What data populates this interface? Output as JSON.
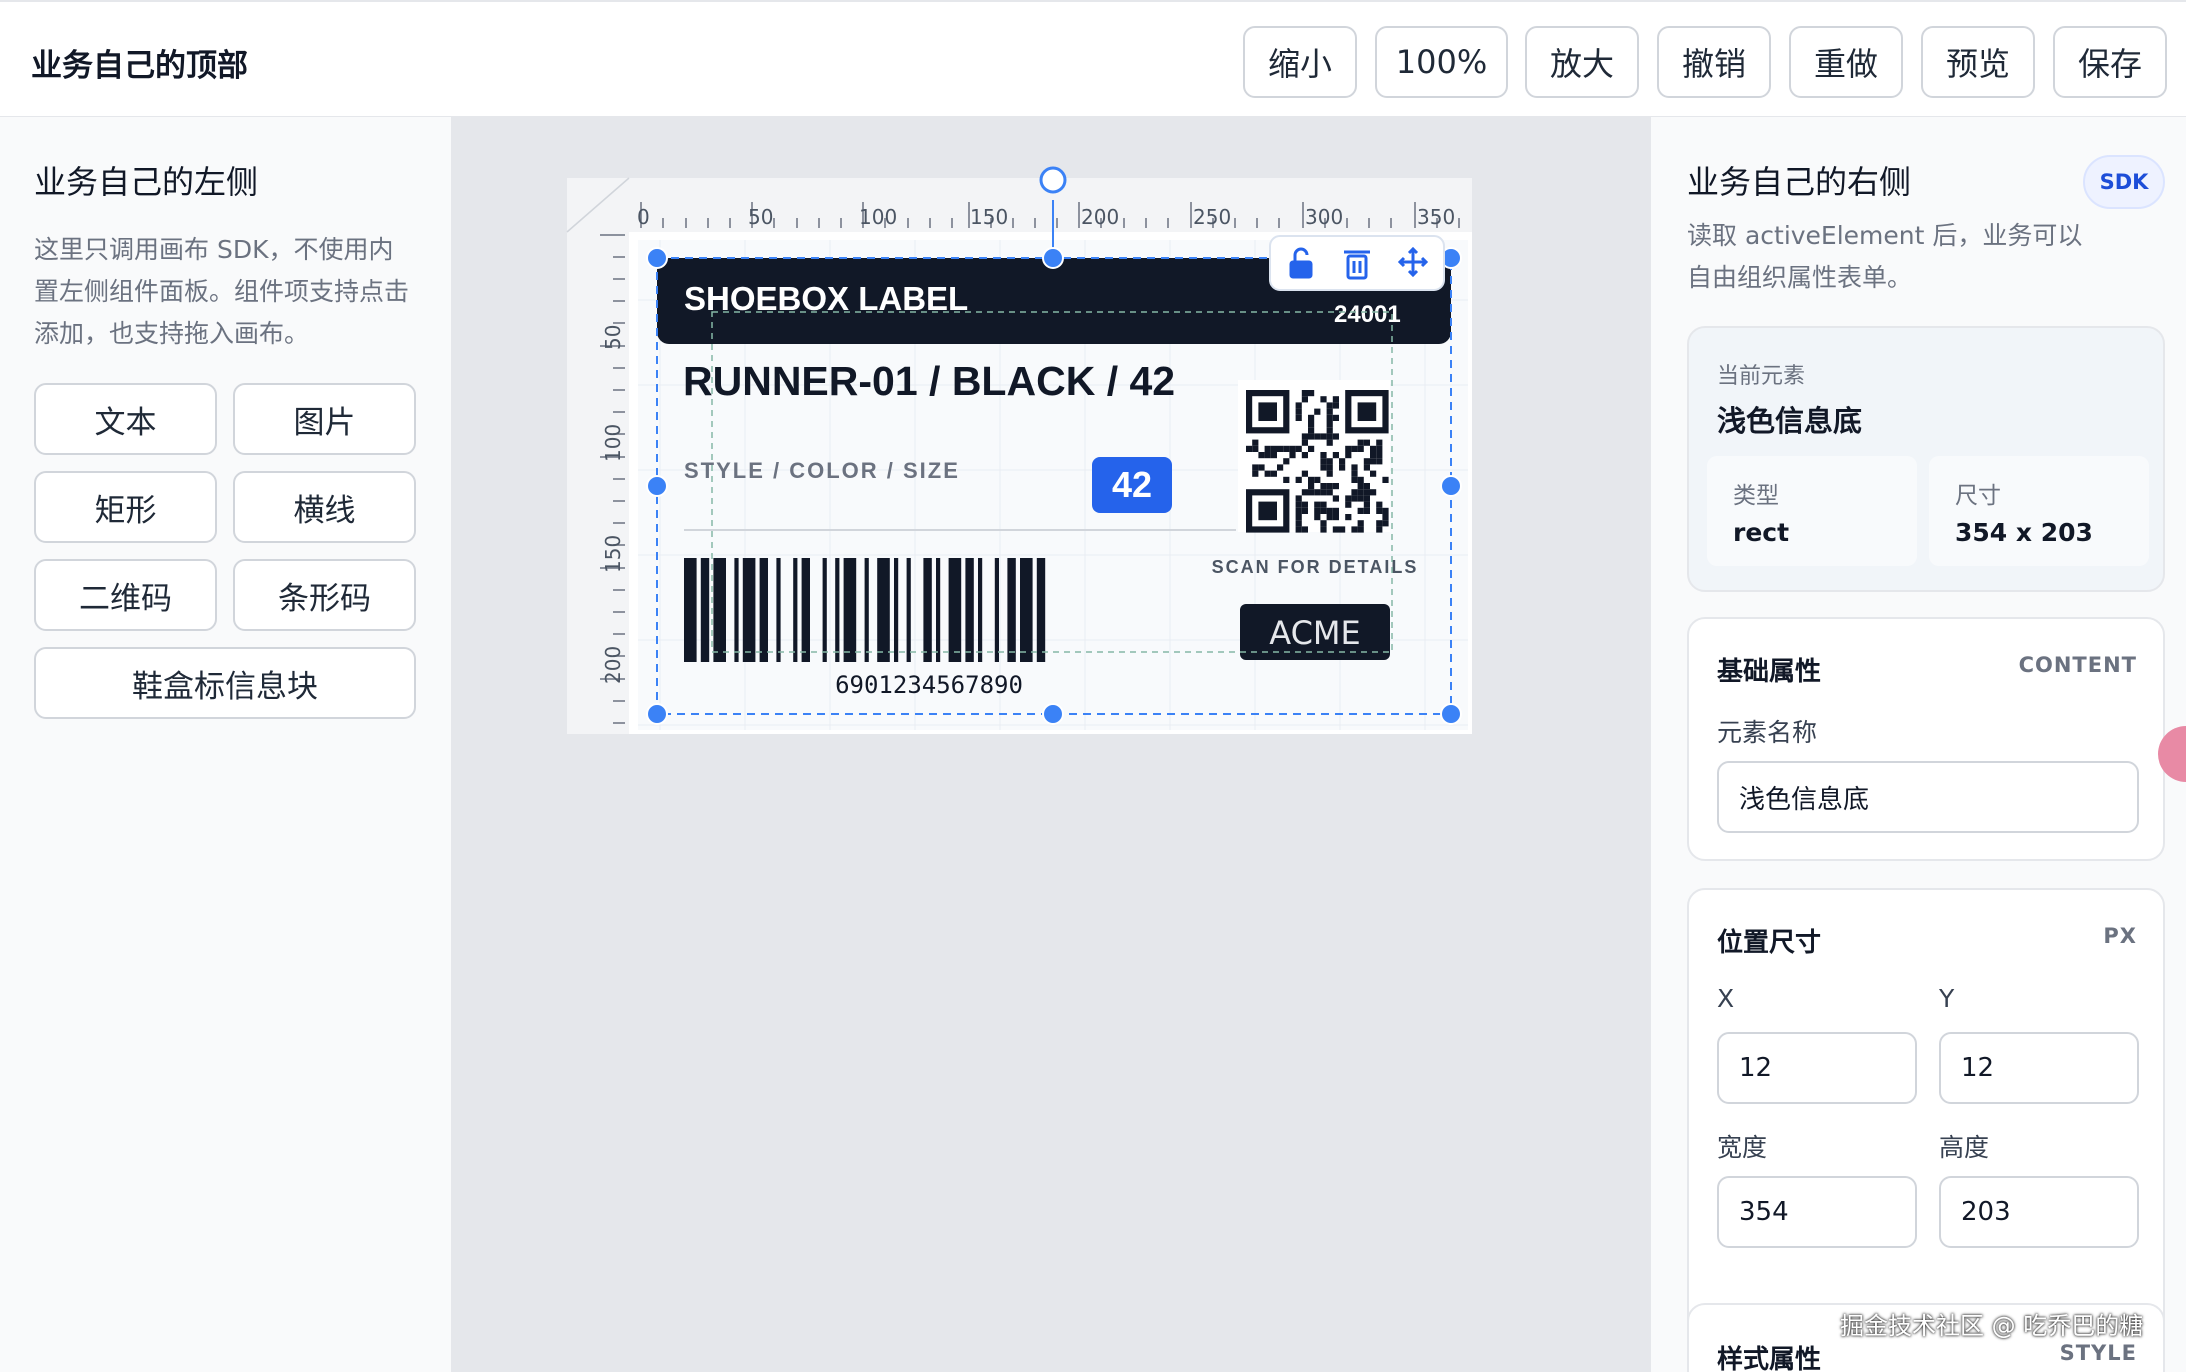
{
  "top": {
    "title": "业务自己的顶部",
    "buttons": [
      "缩小",
      "100%",
      "放大",
      "撤销",
      "重做",
      "预览",
      "保存"
    ]
  },
  "left": {
    "title": "业务自己的左侧",
    "description": "这里只调用画布 SDK，不使用内置左侧组件面板。组件项支持点击添加，也支持拖入画布。",
    "components": [
      "文本",
      "图片",
      "矩形",
      "横线",
      "二维码",
      "条形码",
      "鞋盒标信息块"
    ]
  },
  "canvas": {
    "ruler_x_labels": [
      "0",
      "50",
      "100",
      "150",
      "200",
      "250",
      "300",
      "350"
    ],
    "ruler_y_labels": [
      "50",
      "100",
      "150",
      "200"
    ],
    "label": {
      "header": "SHOEBOX LABEL",
      "header_code": "24001",
      "product": "RUNNER-01 / BLACK / 42",
      "style_line": "STYLE / COLOR / SIZE",
      "size_badge": "42",
      "scan_text": "SCAN FOR DETAILS",
      "brand": "ACME",
      "barcode_number": "6901234567890",
      "colors": {
        "header_bg": "#111827",
        "badge_bg": "#2563eb",
        "selection": "#3b82f6"
      }
    },
    "toolbar_icons": [
      "lock-open-icon",
      "trash-icon",
      "move-icon"
    ]
  },
  "right": {
    "title": "业务自己的右侧",
    "badge": "SDK",
    "description": "读取 activeElement 后，业务可以自由组织属性表单。",
    "current": {
      "section_label": "当前元素",
      "name": "浅色信息底",
      "type_label": "类型",
      "type_value": "rect",
      "size_label": "尺寸",
      "size_value": "354 x 203"
    },
    "basic": {
      "title": "基础属性",
      "tag": "CONTENT",
      "name_label": "元素名称",
      "name_value": "浅色信息底"
    },
    "position": {
      "title": "位置尺寸",
      "tag": "PX",
      "x_label": "X",
      "x_value": "12",
      "y_label": "Y",
      "y_value": "12",
      "w_label": "宽度",
      "w_value": "354",
      "h_label": "高度",
      "h_value": "203"
    },
    "style": {
      "title": "样式属性",
      "tag": "STYLE"
    }
  },
  "watermark": "掘金技术社区 @ 吃乔巴的糖"
}
